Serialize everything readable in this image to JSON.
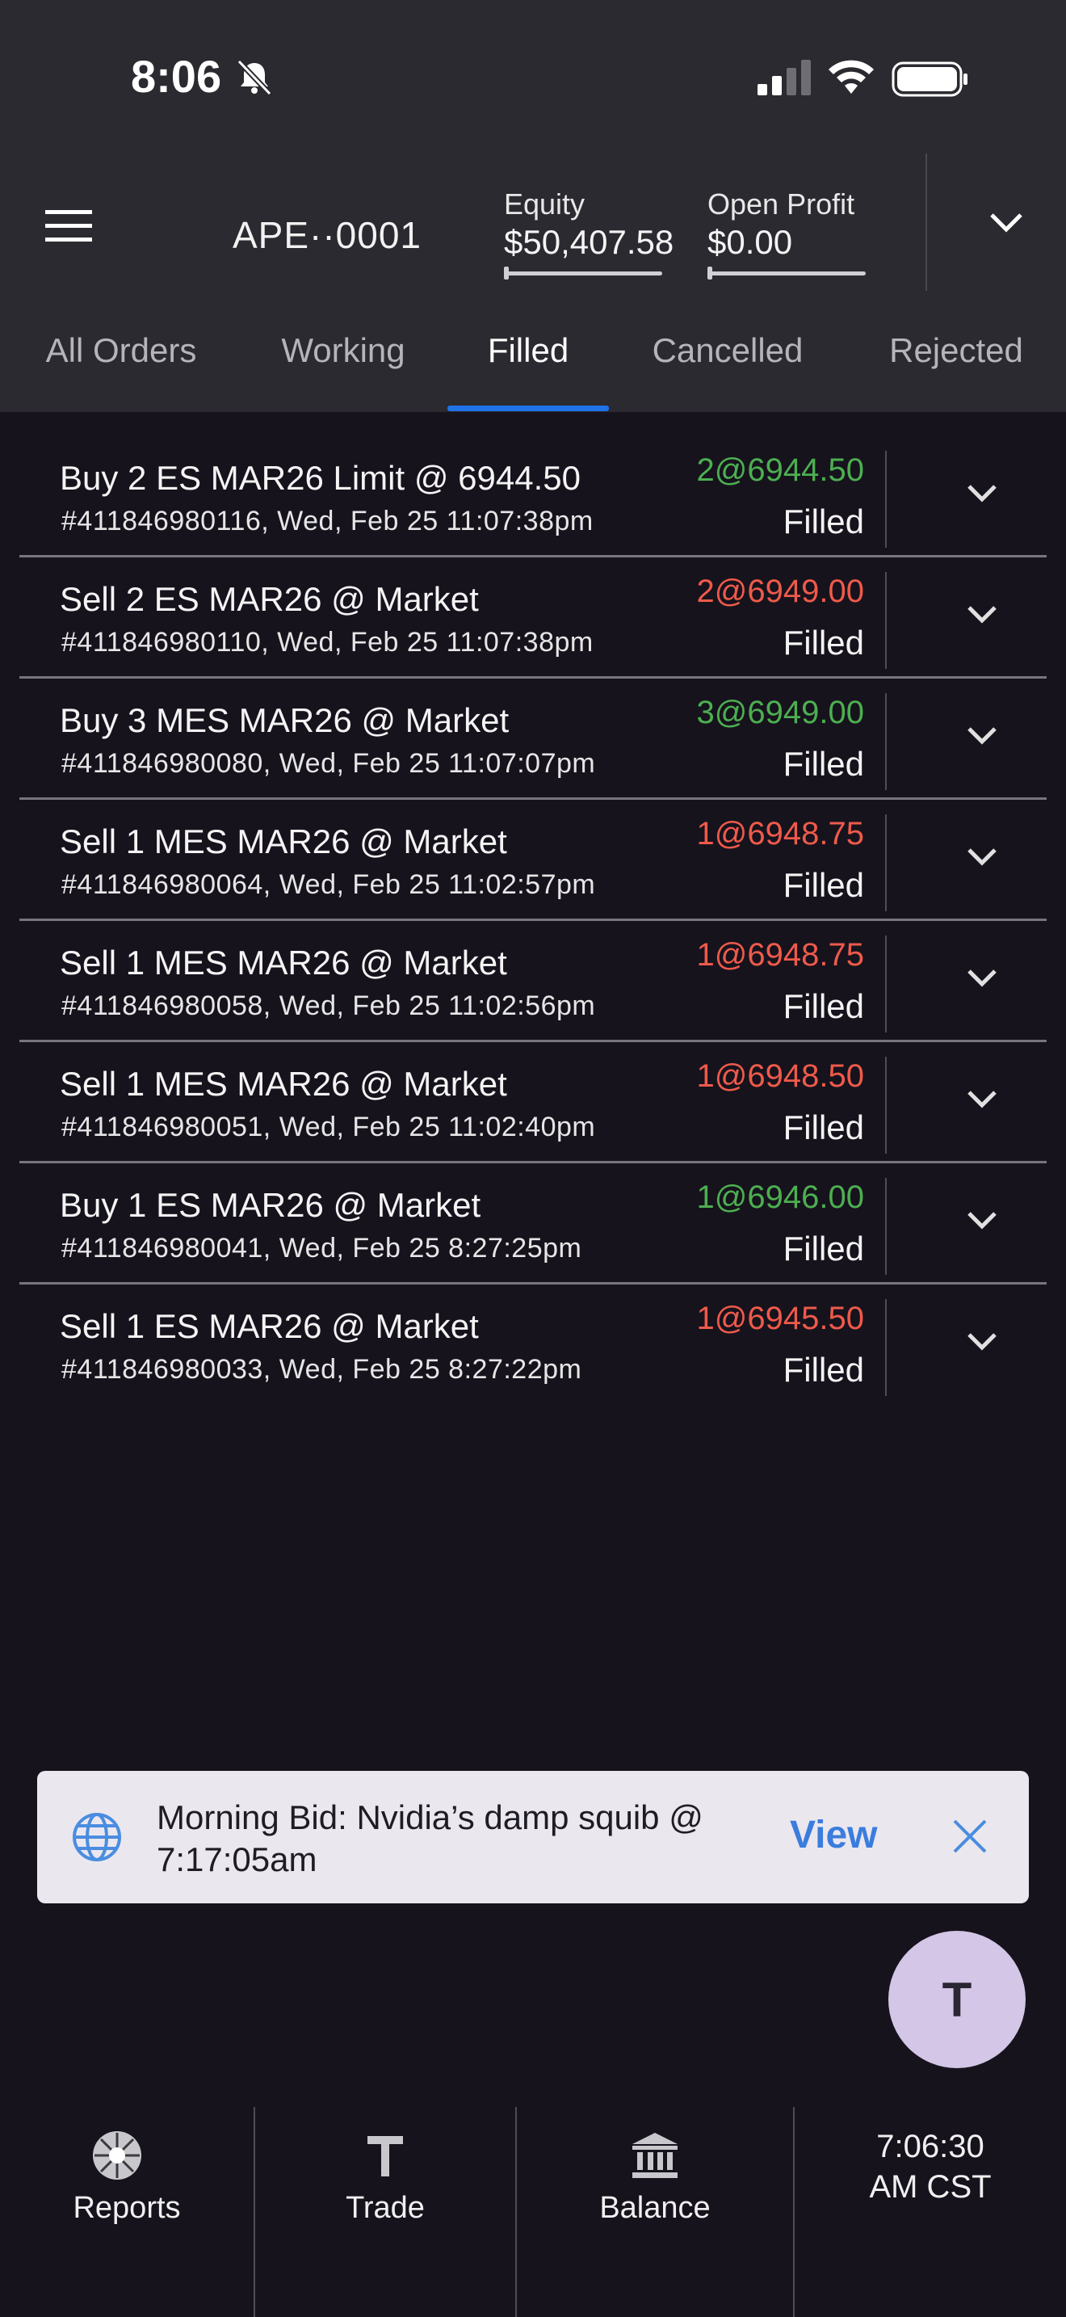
{
  "status_bar": {
    "time": "8:06"
  },
  "header": {
    "account": "APE··0001",
    "equity": {
      "label": "Equity",
      "value": "$50,407.58"
    },
    "open_profit": {
      "label": "Open Profit",
      "value": "$0.00"
    }
  },
  "tabs": [
    {
      "label": "All Orders"
    },
    {
      "label": "Working"
    },
    {
      "label": "Filled"
    },
    {
      "label": "Cancelled"
    },
    {
      "label": "Rejected"
    }
  ],
  "active_tab": "Filled",
  "orders": [
    {
      "title": "Buy 2 ES MAR26 Limit @ 6944.50",
      "sub": "#411846980116, Wed, Feb 25 11:07:38pm",
      "fill": "2@6944.50",
      "side": "buy",
      "status": "Filled"
    },
    {
      "title": "Sell 2 ES MAR26 @ Market",
      "sub": "#411846980110, Wed, Feb 25 11:07:38pm",
      "fill": "2@6949.00",
      "side": "sell",
      "status": "Filled"
    },
    {
      "title": "Buy 3 MES MAR26 @ Market",
      "sub": "#411846980080, Wed, Feb 25 11:07:07pm",
      "fill": "3@6949.00",
      "side": "buy",
      "status": "Filled"
    },
    {
      "title": "Sell 1 MES MAR26 @ Market",
      "sub": "#411846980064, Wed, Feb 25 11:02:57pm",
      "fill": "1@6948.75",
      "side": "sell",
      "status": "Filled"
    },
    {
      "title": "Sell 1 MES MAR26 @ Market",
      "sub": "#411846980058, Wed, Feb 25 11:02:56pm",
      "fill": "1@6948.75",
      "side": "sell",
      "status": "Filled"
    },
    {
      "title": "Sell 1 MES MAR26 @ Market",
      "sub": "#411846980051, Wed, Feb 25 11:02:40pm",
      "fill": "1@6948.50",
      "side": "sell",
      "status": "Filled"
    },
    {
      "title": "Buy 1 ES MAR26 @ Market",
      "sub": "#411846980041, Wed, Feb 25 8:27:25pm",
      "fill": "1@6946.00",
      "side": "buy",
      "status": "Filled"
    },
    {
      "title": "Sell 1 ES MAR26 @ Market",
      "sub": "#411846980033, Wed, Feb 25 8:27:22pm",
      "fill": "1@6945.50",
      "side": "sell",
      "status": "Filled"
    }
  ],
  "notification": {
    "text": "Morning Bid: Nvidia’s damp squib @ 7:17:05am",
    "action": "View"
  },
  "fab": {
    "label": "T"
  },
  "bottom_nav": [
    {
      "label": "Reports",
      "icon": "reports-icon"
    },
    {
      "label": "Trade",
      "icon": "trade-icon"
    },
    {
      "label": "Balance",
      "icon": "bank-icon"
    }
  ],
  "clock": {
    "line1": "7:06:30",
    "line2": "AM CST"
  },
  "colors": {
    "buy": "#4caf50",
    "sell": "#ef5a4a",
    "accent": "#1f72e8",
    "view_link": "#3b7ddd"
  }
}
